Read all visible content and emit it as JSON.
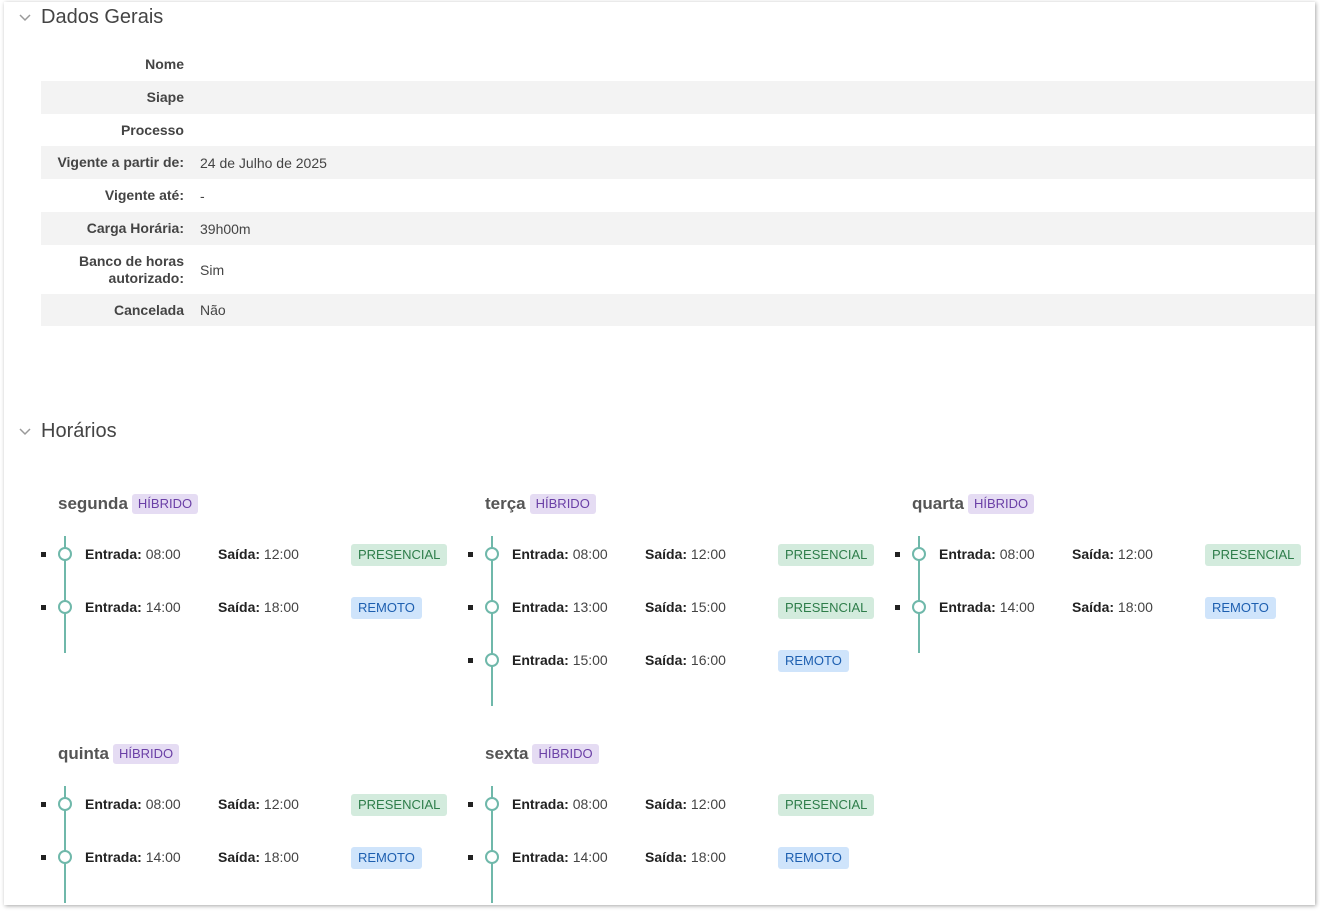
{
  "dados_gerais": {
    "title": "Dados Gerais",
    "rows": [
      {
        "label": "Nome",
        "value": ""
      },
      {
        "label": "Siape",
        "value": ""
      },
      {
        "label": "Processo",
        "value": ""
      },
      {
        "label": "Vigente a partir de:",
        "value": "24 de Julho de 2025"
      },
      {
        "label": "Vigente até:",
        "value": "-"
      },
      {
        "label": "Carga Horária:",
        "value": "39h00m"
      },
      {
        "label": "Banco de horas autorizado:",
        "value": "Sim"
      },
      {
        "label": "Cancelada",
        "value": "Não"
      }
    ]
  },
  "horarios": {
    "title": "Horários",
    "entrada_label": "Entrada:",
    "saida_label": "Saída:",
    "days": [
      {
        "name": "segunda",
        "badge": "HÍBRIDO",
        "entries": [
          {
            "entrada": "08:00",
            "saida": "12:00",
            "tipo": "PRESENCIAL"
          },
          {
            "entrada": "14:00",
            "saida": "18:00",
            "tipo": "REMOTO"
          }
        ]
      },
      {
        "name": "terça",
        "badge": "HÍBRIDO",
        "entries": [
          {
            "entrada": "08:00",
            "saida": "12:00",
            "tipo": "PRESENCIAL"
          },
          {
            "entrada": "13:00",
            "saida": "15:00",
            "tipo": "PRESENCIAL"
          },
          {
            "entrada": "15:00",
            "saida": "16:00",
            "tipo": "REMOTO"
          }
        ]
      },
      {
        "name": "quarta",
        "badge": "HÍBRIDO",
        "entries": [
          {
            "entrada": "08:00",
            "saida": "12:00",
            "tipo": "PRESENCIAL"
          },
          {
            "entrada": "14:00",
            "saida": "18:00",
            "tipo": "REMOTO"
          }
        ]
      },
      {
        "name": "quinta",
        "badge": "HÍBRIDO",
        "entries": [
          {
            "entrada": "08:00",
            "saida": "12:00",
            "tipo": "PRESENCIAL"
          },
          {
            "entrada": "14:00",
            "saida": "18:00",
            "tipo": "REMOTO"
          }
        ]
      },
      {
        "name": "sexta",
        "badge": "HÍBRIDO",
        "entries": [
          {
            "entrada": "08:00",
            "saida": "12:00",
            "tipo": "PRESENCIAL"
          },
          {
            "entrada": "14:00",
            "saida": "18:00",
            "tipo": "REMOTO"
          }
        ]
      }
    ]
  },
  "icons": {
    "section_toggle": "chevron-down-icon",
    "timeline_node": "circle-icon"
  },
  "colors": {
    "hibrido": "#6a3fa6",
    "presencial": "#2e7d4a",
    "remoto": "#1d5fb0",
    "timeline": "#6fb8aa"
  }
}
